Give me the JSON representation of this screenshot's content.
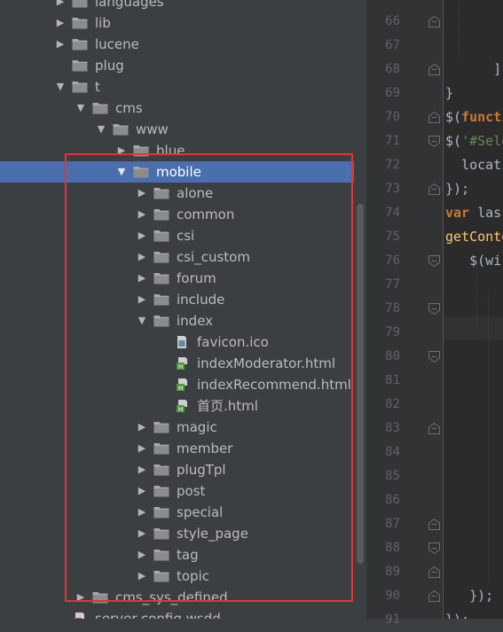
{
  "tree": {
    "rows": [
      {
        "label": "languages",
        "depth": 0,
        "arrow": "closed",
        "selected": false,
        "icon": "folder-icon"
      },
      {
        "label": "lib",
        "depth": 0,
        "arrow": "closed",
        "selected": false,
        "icon": "folder-icon"
      },
      {
        "label": "lucene",
        "depth": 0,
        "arrow": "closed",
        "selected": false,
        "icon": "folder-icon"
      },
      {
        "label": "plug",
        "depth": 0,
        "arrow": "none",
        "selected": false,
        "icon": "folder-icon"
      },
      {
        "label": "t",
        "depth": 0,
        "arrow": "open",
        "selected": false,
        "icon": "folder-icon"
      },
      {
        "label": "cms",
        "depth": 1,
        "arrow": "open",
        "selected": false,
        "icon": "folder-icon"
      },
      {
        "label": "www",
        "depth": 2,
        "arrow": "open",
        "selected": false,
        "icon": "folder-icon"
      },
      {
        "label": "blue",
        "depth": 3,
        "arrow": "closed",
        "selected": false,
        "icon": "folder-icon"
      },
      {
        "label": "mobile",
        "depth": 3,
        "arrow": "open",
        "selected": true,
        "icon": "folder-icon"
      },
      {
        "label": "alone",
        "depth": 4,
        "arrow": "closed",
        "selected": false,
        "icon": "folder-icon"
      },
      {
        "label": "common",
        "depth": 4,
        "arrow": "closed",
        "selected": false,
        "icon": "folder-icon"
      },
      {
        "label": "csi",
        "depth": 4,
        "arrow": "closed",
        "selected": false,
        "icon": "folder-icon"
      },
      {
        "label": "csi_custom",
        "depth": 4,
        "arrow": "closed",
        "selected": false,
        "icon": "folder-icon"
      },
      {
        "label": "forum",
        "depth": 4,
        "arrow": "closed",
        "selected": false,
        "icon": "folder-icon"
      },
      {
        "label": "include",
        "depth": 4,
        "arrow": "closed",
        "selected": false,
        "icon": "folder-icon"
      },
      {
        "label": "index",
        "depth": 4,
        "arrow": "open",
        "selected": false,
        "icon": "folder-icon"
      },
      {
        "label": "favicon.ico",
        "depth": 5,
        "arrow": "none",
        "selected": false,
        "icon": "image-file-icon"
      },
      {
        "label": "indexModerator.html",
        "depth": 5,
        "arrow": "none",
        "selected": false,
        "icon": "html-file-icon"
      },
      {
        "label": "indexRecommend.html",
        "depth": 5,
        "arrow": "none",
        "selected": false,
        "icon": "html-file-icon"
      },
      {
        "label": "首页.html",
        "depth": 5,
        "arrow": "none",
        "selected": false,
        "icon": "html-file-icon"
      },
      {
        "label": "magic",
        "depth": 4,
        "arrow": "closed",
        "selected": false,
        "icon": "folder-icon"
      },
      {
        "label": "member",
        "depth": 4,
        "arrow": "closed",
        "selected": false,
        "icon": "folder-icon"
      },
      {
        "label": "plugTpl",
        "depth": 4,
        "arrow": "closed",
        "selected": false,
        "icon": "folder-icon"
      },
      {
        "label": "post",
        "depth": 4,
        "arrow": "closed",
        "selected": false,
        "icon": "folder-icon"
      },
      {
        "label": "special",
        "depth": 4,
        "arrow": "closed",
        "selected": false,
        "icon": "folder-icon"
      },
      {
        "label": "style_page",
        "depth": 4,
        "arrow": "closed",
        "selected": false,
        "icon": "folder-icon"
      },
      {
        "label": "tag",
        "depth": 4,
        "arrow": "closed",
        "selected": false,
        "icon": "folder-icon"
      },
      {
        "label": "topic",
        "depth": 4,
        "arrow": "closed",
        "selected": false,
        "icon": "folder-icon"
      },
      {
        "label": "cms_sys_defined",
        "depth": 1,
        "arrow": "closed",
        "selected": false,
        "icon": "folder-icon"
      },
      {
        "label": "server-config.wsdd",
        "depth": 0,
        "arrow": "none",
        "selected": false,
        "icon": "xml-file-icon"
      }
    ]
  },
  "gutter": {
    "line_numbers": [
      "66",
      "67",
      "68",
      "69",
      "70",
      "71",
      "72",
      "73",
      "74",
      "75",
      "76",
      "77",
      "78",
      "79",
      "80",
      "81",
      "82",
      "83",
      "84",
      "85",
      "86",
      "87",
      "88",
      "89",
      "90",
      "91"
    ],
    "fold_markers": [
      "fold-end",
      "",
      "fold-end",
      "",
      "fold-end",
      "fold-start",
      "",
      "fold-end",
      "",
      "",
      "fold-start",
      "",
      "fold-start",
      "",
      "fold-start",
      "",
      "",
      "fold-end",
      "",
      "",
      "",
      "fold-end",
      "fold-start",
      "fold-end",
      "fold-end",
      ""
    ]
  },
  "editor": {
    "lines": [
      [
        {
          "t": "",
          "c": "plain"
        }
      ],
      [
        {
          "t": "",
          "c": "plain"
        }
      ],
      [
        {
          "t": "      ]",
          "c": "plain"
        }
      ],
      [
        {
          "t": "}",
          "c": "plain"
        }
      ],
      [
        {
          "t": "$(",
          "c": "plain"
        },
        {
          "t": "functi",
          "c": "kw"
        }
      ],
      [
        {
          "t": "$(",
          "c": "plain"
        },
        {
          "t": "'#Sele",
          "c": "str"
        }
      ],
      [
        {
          "t": "  locati",
          "c": "plain"
        }
      ],
      [
        {
          "t": "});",
          "c": "plain"
        }
      ],
      [
        {
          "t": "var",
          "c": "kw"
        },
        {
          "t": " las",
          "c": "plain"
        }
      ],
      [
        {
          "t": "getConte",
          "c": "fn"
        }
      ],
      [
        {
          "t": "   $(wi",
          "c": "plain"
        }
      ],
      [
        {
          "t": "",
          "c": "plain"
        }
      ],
      [
        {
          "t": "",
          "c": "plain"
        }
      ],
      [
        {
          "t": "",
          "c": "plain"
        }
      ],
      [
        {
          "t": "",
          "c": "plain"
        }
      ],
      [
        {
          "t": "",
          "c": "plain"
        }
      ],
      [
        {
          "t": "",
          "c": "plain"
        }
      ],
      [
        {
          "t": "",
          "c": "plain"
        }
      ],
      [
        {
          "t": "",
          "c": "plain"
        }
      ],
      [
        {
          "t": "",
          "c": "plain"
        }
      ],
      [
        {
          "t": "",
          "c": "plain"
        }
      ],
      [
        {
          "t": "",
          "c": "plain"
        }
      ],
      [
        {
          "t": "",
          "c": "plain"
        }
      ],
      [
        {
          "t": "",
          "c": "plain"
        }
      ],
      [
        {
          "t": "   });",
          "c": "plain"
        }
      ],
      [
        {
          "t": "});",
          "c": "plain"
        }
      ]
    ]
  },
  "colors": {
    "selection": "#4b6eaf",
    "highlight_box": "#e03535",
    "folder": "#a9a9a9",
    "keyword": "#cc7832",
    "string": "#6a8759",
    "function": "#ffc66d"
  }
}
